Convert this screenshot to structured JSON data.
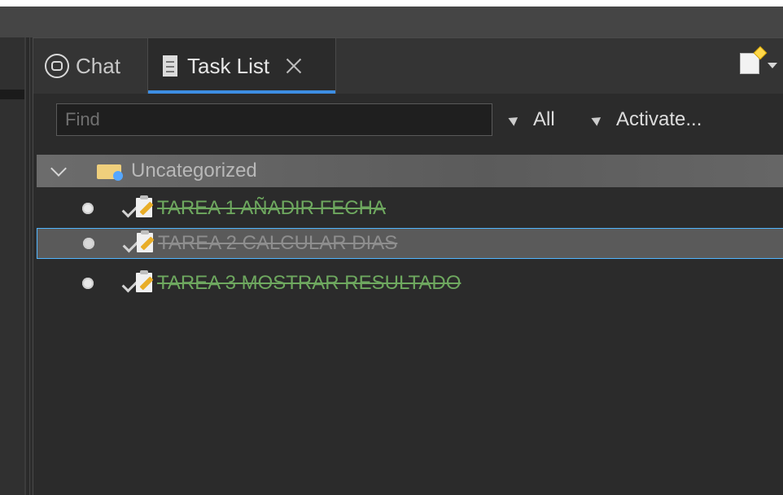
{
  "tabs": {
    "chat": "Chat",
    "task_list": "Task List"
  },
  "toolbar": {
    "find_placeholder": "Find",
    "filter_all": "All",
    "filter_activate": "Activate..."
  },
  "tree": {
    "category": "Uncategorized",
    "tasks": [
      {
        "label": "TAREA 1 AÑADIR FECHA"
      },
      {
        "label": "TAREA 2 CALCULAR DIAS"
      },
      {
        "label": "TAREA 3 MOSTRAR RESULTADO"
      }
    ]
  }
}
